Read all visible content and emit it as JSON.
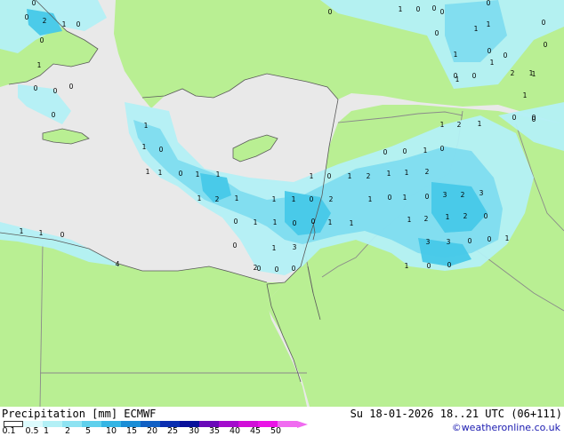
{
  "map": {
    "colors": {
      "sea": "#e9e9e9",
      "land": "#b9ef93",
      "border": "#8a8a8a",
      "coast": "#5a5a5a",
      "rain_light": "#b3f0f6",
      "rain_mid": "#7fdcef",
      "rain_heavy": "#46c8e8"
    },
    "labels": [
      {
        "t": "0"
      },
      {
        "t": "0"
      },
      {
        "t": "2"
      },
      {
        "t": "1"
      },
      {
        "t": "0"
      },
      {
        "t": "0"
      },
      {
        "t": "1"
      },
      {
        "t": "0"
      },
      {
        "t": "0"
      },
      {
        "t": "0"
      },
      {
        "t": "0"
      },
      {
        "t": "0"
      },
      {
        "t": "1"
      },
      {
        "t": "0"
      },
      {
        "t": "0"
      },
      {
        "t": "0"
      },
      {
        "t": "0"
      },
      {
        "t": "1"
      },
      {
        "t": "1"
      },
      {
        "t": "0"
      },
      {
        "t": "0"
      },
      {
        "t": "1"
      },
      {
        "t": "0"
      },
      {
        "t": "1"
      },
      {
        "t": "0"
      },
      {
        "t": "1"
      },
      {
        "t": "2"
      },
      {
        "t": "1"
      },
      {
        "t": "0"
      },
      {
        "t": "1"
      },
      {
        "t": "0"
      },
      {
        "t": "0"
      },
      {
        "t": "1"
      },
      {
        "t": "1"
      },
      {
        "t": "0"
      },
      {
        "t": "1"
      },
      {
        "t": "1"
      },
      {
        "t": "0"
      },
      {
        "t": "1"
      },
      {
        "t": "1"
      },
      {
        "t": "1"
      },
      {
        "t": "0"
      },
      {
        "t": "1"
      },
      {
        "t": "2"
      },
      {
        "t": "1"
      },
      {
        "t": "1"
      },
      {
        "t": "2"
      },
      {
        "t": "0"
      },
      {
        "t": "0"
      },
      {
        "t": "1"
      },
      {
        "t": "0"
      },
      {
        "t": "1"
      },
      {
        "t": "2"
      },
      {
        "t": "1"
      },
      {
        "t": "1"
      },
      {
        "t": "2"
      },
      {
        "t": "1"
      },
      {
        "t": "1"
      },
      {
        "t": "1"
      },
      {
        "t": "0"
      },
      {
        "t": "2"
      },
      {
        "t": "1"
      },
      {
        "t": "0"
      },
      {
        "t": "1"
      },
      {
        "t": "0"
      },
      {
        "t": "3"
      },
      {
        "t": "2"
      },
      {
        "t": "3"
      },
      {
        "t": "0"
      },
      {
        "t": "1"
      },
      {
        "t": "1"
      },
      {
        "t": "0"
      },
      {
        "t": "0"
      },
      {
        "t": "1"
      },
      {
        "t": "1"
      },
      {
        "t": "1"
      },
      {
        "t": "2"
      },
      {
        "t": "1"
      },
      {
        "t": "2"
      },
      {
        "t": "0"
      },
      {
        "t": "1"
      },
      {
        "t": "1"
      },
      {
        "t": "0"
      },
      {
        "t": "0"
      },
      {
        "t": "1"
      },
      {
        "t": "3"
      },
      {
        "t": "3"
      },
      {
        "t": "3"
      },
      {
        "t": "0"
      },
      {
        "t": "0"
      },
      {
        "t": "1"
      },
      {
        "t": "0"
      },
      {
        "t": "0"
      },
      {
        "t": "0"
      },
      {
        "t": "1"
      },
      {
        "t": "0"
      },
      {
        "t": "0"
      },
      {
        "t": "4"
      },
      {
        "t": "2"
      },
      {
        "t": "1"
      },
      {
        "t": "0"
      },
      {
        "t": "0"
      },
      {
        "t": "0"
      }
    ]
  },
  "footer": {
    "title_left": "Precipitation [mm] ECMWF",
    "title_right": "Su 18-01-2026 18..21 UTC (06+111)",
    "credit": "©weatheronline.co.uk"
  },
  "colorbar": {
    "ticks": [
      "0.1",
      "0.5",
      "1",
      "2",
      "5",
      "10",
      "15",
      "20",
      "25",
      "30",
      "35",
      "40",
      "45",
      "50"
    ],
    "colors": [
      "#ffffff",
      "#dcfafc",
      "#b3f0f6",
      "#8ee3f2",
      "#5fd0ec",
      "#35b5e4",
      "#1b8ed6",
      "#1060c4",
      "#0a2fb0",
      "#08109a",
      "#6a0ab8",
      "#a30ccc",
      "#d10ed8",
      "#ea14e6",
      "#f06bf0"
    ]
  }
}
